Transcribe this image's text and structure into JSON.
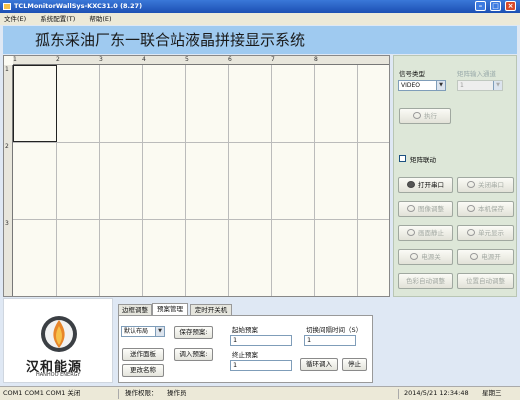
{
  "window": {
    "title": "TCLMonitorWallSys-KXC31.0 (8.27)"
  },
  "menu": [
    "文件(E)",
    "系统配置(T)",
    "帮助(E)"
  ],
  "banner": {
    "title": "孤东采油厂东一联合站液晶拼接显示系统"
  },
  "grid": {
    "columns": [
      "1",
      "2",
      "3",
      "4",
      "5",
      "6",
      "7",
      "8"
    ],
    "rows": [
      "1",
      "2",
      "3"
    ]
  },
  "side": {
    "signal_type_label": "信号类型",
    "signal_type_value": "VIDEO",
    "matrix_input_label": "矩阵输入通道",
    "matrix_input_value": "1",
    "execute": "执行",
    "matrix_link_label": "矩阵联动",
    "buttons": [
      {
        "label": "打开串口",
        "enabled": true,
        "icon": "serial-open-icon"
      },
      {
        "label": "关闭串口",
        "enabled": false,
        "icon": "serial-close-icon"
      },
      {
        "label": "图像调整",
        "enabled": false,
        "icon": "image-adjust-icon"
      },
      {
        "label": "本机保存",
        "enabled": false,
        "icon": "save-local-icon"
      },
      {
        "label": "画面静止",
        "enabled": false,
        "icon": "freeze-icon"
      },
      {
        "label": "单元显示",
        "enabled": false,
        "icon": "unit-display-icon"
      },
      {
        "label": "电源关",
        "enabled": false,
        "icon": "power-off-icon"
      },
      {
        "label": "电源开",
        "enabled": false,
        "icon": "power-on-icon"
      },
      {
        "label": "色彩自动调整",
        "enabled": false,
        "icon": ""
      },
      {
        "label": "位置自动调整",
        "enabled": false,
        "icon": ""
      }
    ]
  },
  "logo": {
    "cn": "汉和能源",
    "en": "HANHOO ENERGY"
  },
  "tabs": [
    "边框调整",
    "预案管理",
    "定时开关机"
  ],
  "preset": {
    "layout_value": "默认布局",
    "save_preset": "保存预案:",
    "load_preset": "调入预案:",
    "back_panel": "送作面板",
    "rename": "更改名称",
    "start_label": "起始预案",
    "start_value": "1",
    "interval_label": "切换间隔时间（S）",
    "interval_value": "1",
    "end_label": "终止预案",
    "end_value": "1",
    "loop_load": "循环调入",
    "stop": "停止"
  },
  "status": {
    "ports": "COM1 COM1 COM1 关闭",
    "permission_label": "操作权限：",
    "permission_value": "操作员",
    "datetime": "2014/5/21 12:34:48",
    "weekday": "星期三"
  }
}
